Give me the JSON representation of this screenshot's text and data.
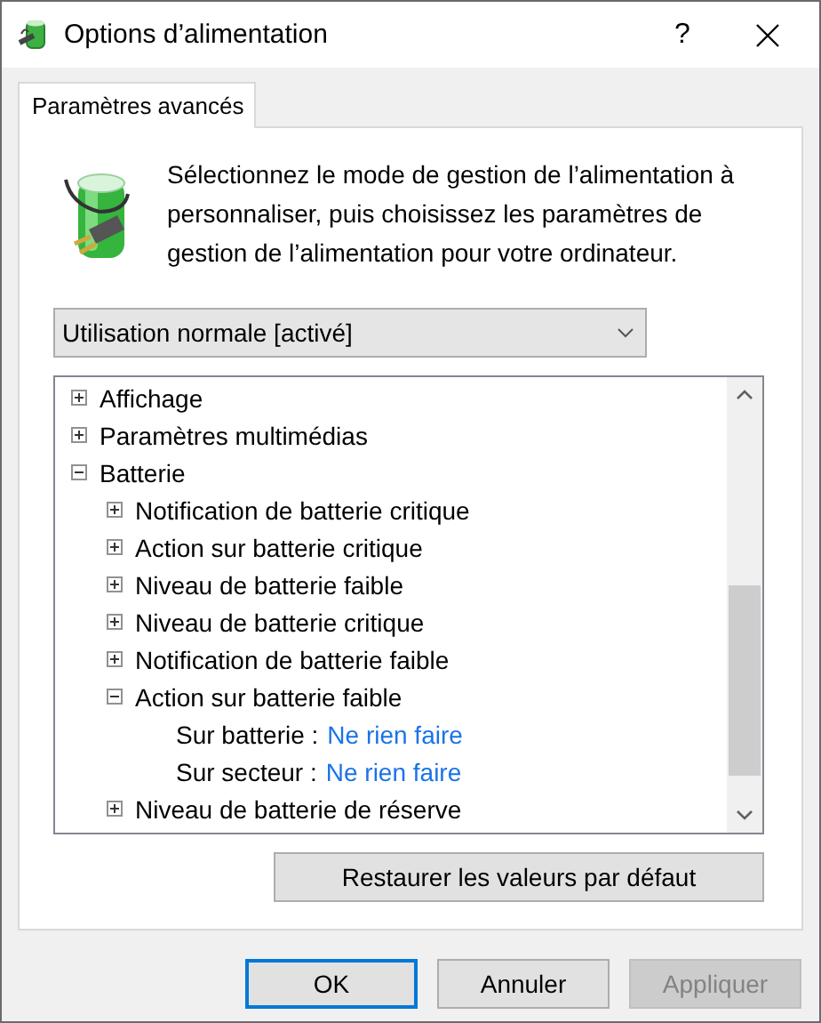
{
  "window": {
    "title": "Options d’alimentation",
    "help": "?"
  },
  "tabs": [
    {
      "label": "Paramètres avancés",
      "selected": true
    }
  ],
  "description": "Sélectionnez le mode de gestion de l’alimentation à personnaliser, puis choisissez les paramètres de gestion de l’alimentation pour votre ordinateur.",
  "plan_dropdown": {
    "value": "Utilisation normale [activé]"
  },
  "tree": {
    "items": [
      {
        "label": "Affichage",
        "expanded": false
      },
      {
        "label": "Paramètres multimédias",
        "expanded": false
      },
      {
        "label": "Batterie",
        "expanded": true,
        "children": [
          {
            "label": "Notification de batterie critique",
            "expanded": false
          },
          {
            "label": "Action sur batterie critique",
            "expanded": false
          },
          {
            "label": "Niveau de batterie faible",
            "expanded": false
          },
          {
            "label": "Niveau de batterie critique",
            "expanded": false
          },
          {
            "label": "Notification de batterie faible",
            "expanded": false
          },
          {
            "label": "Action sur batterie faible",
            "expanded": true,
            "settings": [
              {
                "label": "Sur batterie :",
                "value": "Ne rien faire"
              },
              {
                "label": "Sur secteur :",
                "value": "Ne rien faire"
              }
            ]
          },
          {
            "label": "Niveau de batterie de réserve",
            "expanded": false
          }
        ]
      }
    ]
  },
  "restore_button": "Restaurer les valeurs par défaut",
  "buttons": [
    {
      "label": "OK",
      "default": true,
      "disabled": false
    },
    {
      "label": "Annuler",
      "default": false,
      "disabled": false
    },
    {
      "label": "Appliquer",
      "default": false,
      "disabled": true
    }
  ]
}
